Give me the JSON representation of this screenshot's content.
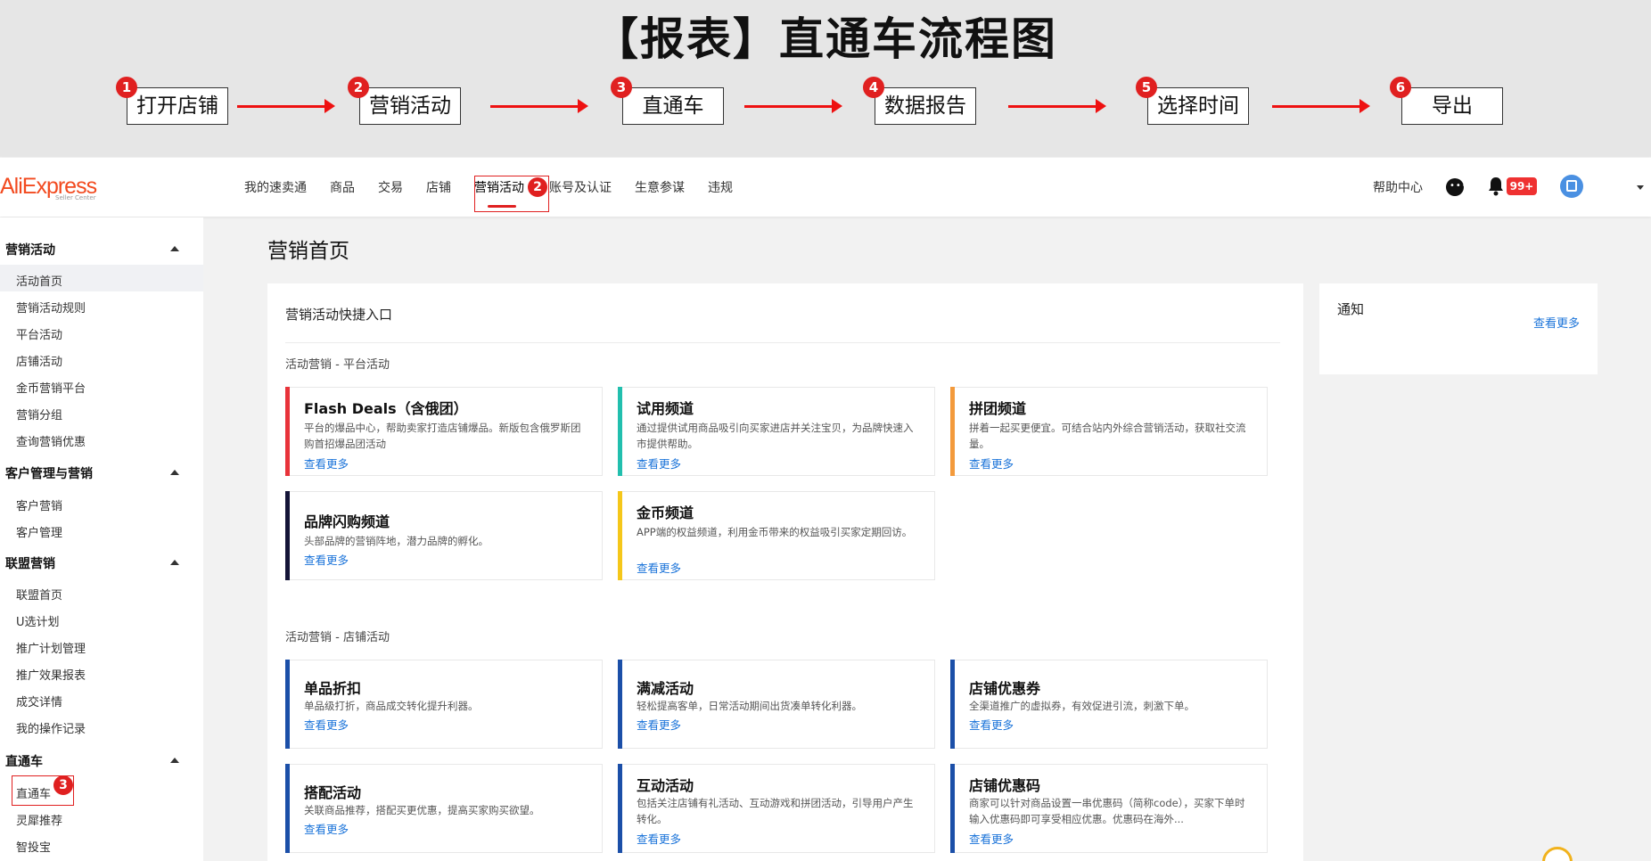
{
  "banner": {
    "title": "【报表】直通车流程图",
    "steps": [
      {
        "num": "1",
        "label": "打开店铺"
      },
      {
        "num": "2",
        "label": "营销活动"
      },
      {
        "num": "3",
        "label": "直通车"
      },
      {
        "num": "4",
        "label": "数据报告"
      },
      {
        "num": "5",
        "label": "选择时间"
      },
      {
        "num": "6",
        "label": "导出"
      }
    ]
  },
  "header": {
    "logo": "AliExpress",
    "logo_sub": "Seller Center",
    "nav": [
      "我的速卖通",
      "商品",
      "交易",
      "店铺",
      "营销活动",
      "账号及认证",
      "生意参谋",
      "违规"
    ],
    "active_nav": "营销活动",
    "nav_marker": "2",
    "help": "帮助中心",
    "notify_count": "99+",
    "colors": {
      "accent": "#e02020",
      "brand": "#f24a1f",
      "link": "#1a73d9"
    }
  },
  "sidebar": {
    "groups": [
      {
        "title": "营销活动",
        "items": [
          "活动首页",
          "营销活动规则",
          "平台活动",
          "店铺活动",
          "金币营销平台",
          "营销分组",
          "查询营销优惠"
        ]
      },
      {
        "title": "客户管理与营销",
        "items": [
          "客户营销",
          "客户管理"
        ]
      },
      {
        "title": "联盟营销",
        "items": [
          "联盟首页",
          "U选计划",
          "推广计划管理",
          "推广效果报表",
          "成交详情",
          "我的操作记录"
        ]
      },
      {
        "title": "直通车",
        "items": [
          "直通车",
          "灵犀推荐",
          "智投宝"
        ]
      }
    ],
    "marker": "3"
  },
  "main": {
    "page_title": "营销首页",
    "quick_title": "营销活动快捷入口",
    "section_platform": "活动营销 - 平台活动",
    "section_store": "活动营销 - 店铺活动",
    "more": "查看更多",
    "platform_tiles": [
      {
        "title": "Flash Deals（含俄团）",
        "desc": "平台的爆品中心，帮助卖家打造店铺爆品。新版包含俄罗斯团购首招爆品团活动",
        "color": "#e8333a"
      },
      {
        "title": "试用频道",
        "desc": "通过提供试用商品吸引向买家进店并关注宝贝，为品牌快速入市提供帮助。",
        "color": "#22bfae"
      },
      {
        "title": "拼团频道",
        "desc": "拼着一起买更便宜。可结合站内外综合营销活动，获取社交流量。",
        "color": "#f39a3c"
      },
      {
        "title": "品牌闪购频道",
        "desc": "头部品牌的营销阵地，潜力品牌的孵化。",
        "color": "#141437"
      },
      {
        "title": "金币频道",
        "desc": "APP端的权益频道，利用金币带来的权益吸引买家定期回访。",
        "color": "#f5c71a"
      }
    ],
    "store_tiles": [
      {
        "title": "单品折扣",
        "desc": "单品级打折，商品成交转化提升利器。",
        "color": "#1b4fa8"
      },
      {
        "title": "满减活动",
        "desc": "轻松提高客单，日常活动期间出货凑单转化利器。",
        "color": "#1b4fa8"
      },
      {
        "title": "店铺优惠券",
        "desc": "全渠道推广的虚拟券，有效促进引流，刺激下单。",
        "color": "#1b4fa8"
      },
      {
        "title": "搭配活动",
        "desc": "关联商品推荐，搭配买更优惠，提高买家购买欲望。",
        "color": "#1b4fa8"
      },
      {
        "title": "互动活动",
        "desc": "包括关注店铺有礼活动、互动游戏和拼团活动，引导用户产生转化。",
        "color": "#1b4fa8"
      },
      {
        "title": "店铺优惠码",
        "desc": "商家可以针对商品设置一串优惠码（简称code），买家下单时输入优惠码即可享受相应优惠。优惠码在海外...",
        "color": "#1b4fa8"
      }
    ]
  },
  "notice": {
    "title": "通知",
    "more": "查看更多"
  }
}
